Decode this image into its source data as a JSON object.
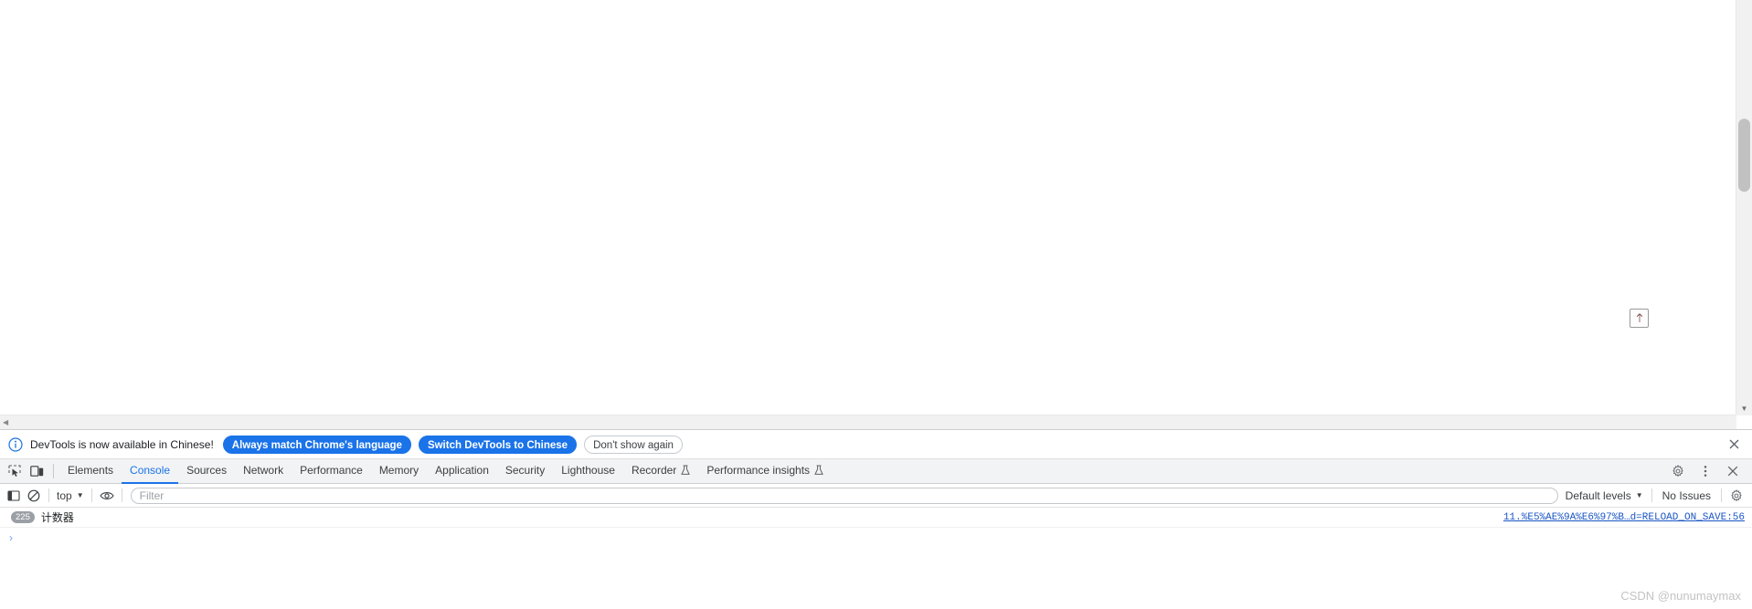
{
  "page": {
    "scroll_top_button": "scroll-to-top",
    "vertical_scrollbar": "page-vertical-scrollbar",
    "horizontal_scrollbar": "page-horizontal-scrollbar"
  },
  "infobar": {
    "icon": "info-circle-icon",
    "message": "DevTools is now available in Chinese!",
    "buttons": [
      {
        "label": "Always match Chrome's language",
        "style": "primary"
      },
      {
        "label": "Switch DevTools to Chinese",
        "style": "primary"
      },
      {
        "label": "Don't show again",
        "style": "outline"
      }
    ],
    "close_icon": "close-icon"
  },
  "tabstrip": {
    "left_icons": [
      {
        "name": "inspect-element-icon"
      },
      {
        "name": "device-toolbar-icon"
      }
    ],
    "tabs": [
      {
        "label": "Elements",
        "selected": false,
        "experimental": false
      },
      {
        "label": "Console",
        "selected": true,
        "experimental": false
      },
      {
        "label": "Sources",
        "selected": false,
        "experimental": false
      },
      {
        "label": "Network",
        "selected": false,
        "experimental": false
      },
      {
        "label": "Performance",
        "selected": false,
        "experimental": false
      },
      {
        "label": "Memory",
        "selected": false,
        "experimental": false
      },
      {
        "label": "Application",
        "selected": false,
        "experimental": false
      },
      {
        "label": "Security",
        "selected": false,
        "experimental": false
      },
      {
        "label": "Lighthouse",
        "selected": false,
        "experimental": false
      },
      {
        "label": "Recorder",
        "selected": false,
        "experimental": true
      },
      {
        "label": "Performance insights",
        "selected": false,
        "experimental": true
      }
    ],
    "right_icons": [
      {
        "name": "settings-gear-icon"
      },
      {
        "name": "more-options-icon"
      },
      {
        "name": "close-devtools-icon"
      }
    ]
  },
  "console_toolbar": {
    "sidebar_icon": "console-sidebar-icon",
    "clear_icon": "clear-console-icon",
    "context": "top",
    "context_caret": "▼",
    "eye_icon": "live-expression-icon",
    "filter_placeholder": "Filter",
    "filter_value": "",
    "levels_label": "Default levels",
    "levels_caret": "▼",
    "issues_label": "No Issues",
    "settings_icon": "console-settings-gear-icon"
  },
  "console_output": {
    "messages": [
      {
        "count": "225",
        "text": "计数器",
        "source": "11.%E5%AE%9A%E6%97%B…d=RELOAD_ON_SAVE:56"
      }
    ],
    "prompt_caret": "›"
  },
  "watermark": {
    "text": "CSDN @nunumaymax"
  },
  "colors": {
    "accent": "#1a73e8",
    "tabstrip_bg": "#f1f3f4",
    "link": "#1a55c4",
    "badge": "#9aa0a6"
  }
}
